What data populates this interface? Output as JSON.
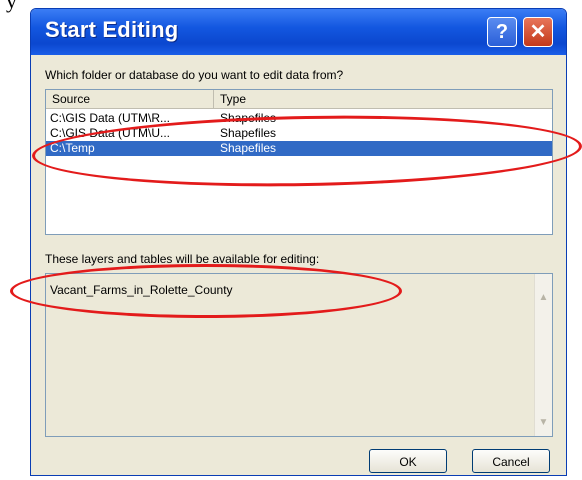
{
  "dialog": {
    "title": "Start Editing",
    "help_glyph": "?",
    "close_glyph": "✕",
    "prompt_source": "Which folder or database do you want to edit data from?",
    "columns": {
      "source": "Source",
      "type": "Type"
    },
    "rows": [
      {
        "source": "C:\\GIS Data (UTM\\R...",
        "type": "Shapefiles"
      },
      {
        "source": "C:\\GIS Data (UTM\\U...",
        "type": "Shapefiles"
      },
      {
        "source": "C:\\Temp",
        "type": "Shapefiles",
        "selected": true
      }
    ],
    "prompt_layers": "These layers and tables will be available for editing:",
    "layers": [
      "Vacant_Farms_in_Rolette_County"
    ],
    "ok_label": "OK",
    "cancel_label": "Cancel"
  },
  "background_text": "y",
  "colors": {
    "titlebar": "#0b47cf",
    "selection": "#316ac5",
    "annotation": "#e31b1b",
    "dialog_bg": "#ece9d8"
  },
  "icons": {
    "help": "help-icon",
    "close": "close-icon",
    "scroll_up": "scroll-up-icon",
    "scroll_down": "scroll-down-icon"
  }
}
